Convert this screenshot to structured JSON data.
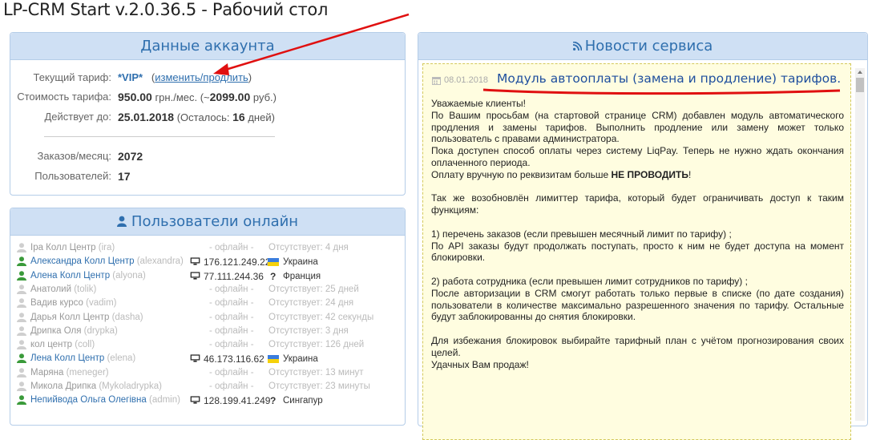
{
  "page_title": "LP-CRM Start v.2.0.36.5 - Рабочий стол",
  "account": {
    "title": "Данные аккаунта",
    "tariff_label": "Текущий тариф:",
    "tariff_value": "*VIP*",
    "change_link": "изменить/продлить",
    "cost_label": "Стоимость тарифа:",
    "cost_value": "950.00",
    "cost_suffix": " грн./мес. (~",
    "cost_alt": "2099.00",
    "cost_alt_suffix": " руб.)",
    "valid_label": "Действует до:",
    "valid_date": "25.01.2018",
    "remaining_prefix": " (Осталось: ",
    "remaining_days": "16",
    "remaining_suffix": " дней)",
    "orders_label": "Заказов/месяц:",
    "orders_value": "2072",
    "users_label": "Пользователей:",
    "users_value": "17"
  },
  "users_panel": {
    "title": "Пользователи онлайн",
    "rows": [
      {
        "name": "Ipa Колл Центр",
        "login": "(ira)",
        "online": false,
        "ip": "- офлайн -",
        "status": "Отсутствует: 4 дня"
      },
      {
        "name": "Александра Колл Центр",
        "login": "(alexandra)",
        "online": true,
        "ip": "176.121.249.229",
        "country": "Украина",
        "flag": "ua"
      },
      {
        "name": "Алена Колл Центр",
        "login": "(alyona)",
        "online": true,
        "ip": "77.111.244.36",
        "country": "Франция",
        "flag": "unknown"
      },
      {
        "name": "Анатолий",
        "login": "(tolik)",
        "online": false,
        "ip": "- офлайн -",
        "status": "Отсутствует: 25 дней"
      },
      {
        "name": "Вадив курсо",
        "login": "(vadim)",
        "online": false,
        "ip": "- офлайн -",
        "status": "Отсутствует: 24 дня"
      },
      {
        "name": "Дарья Колл Центр",
        "login": "(dasha)",
        "online": false,
        "ip": "- офлайн -",
        "status": "Отсутствует: 42 секунды"
      },
      {
        "name": "Дрипка Оля",
        "login": "(drypka)",
        "online": false,
        "ip": "- офлайн -",
        "status": "Отсутствует: 3 дня"
      },
      {
        "name": "кол центр",
        "login": "(coll)",
        "online": false,
        "ip": "- офлайн -",
        "status": "Отсутствует: 126 дней"
      },
      {
        "name": "Лена Колл Центр",
        "login": "(elena)",
        "online": true,
        "ip": "46.173.116.62",
        "country": "Украина",
        "flag": "ua"
      },
      {
        "name": "Маряна",
        "login": "(meneger)",
        "online": false,
        "ip": "- офлайн -",
        "status": "Отсутствует: 13 минут"
      },
      {
        "name": "Микола Дрипка",
        "login": "(Mykoladrypka)",
        "online": false,
        "ip": "- офлайн -",
        "status": "Отсутствует: 23 минуты"
      },
      {
        "name": "Непийвода Ольга Олегівна",
        "login": "(admin)",
        "online": true,
        "ip": "128.199.41.249",
        "country": "Сингапур",
        "flag": "unknown"
      }
    ]
  },
  "news": {
    "title": "Новости сервиса",
    "date": "08.01.2018",
    "headline": "Модуль автооплаты (замена и продление) тарифов.",
    "paragraphs": [
      "Уважаемые клиенты!",
      "По Вашим просьбам (на стартовой странице CRM) добавлен модуль автоматического продления и замены тарифов. Выполнить продление или замену может только пользователь с правами администратора.",
      "Пока доступен способ оплаты через систему LiqPay. Теперь не нужно ждать окончания оплаченного периода.",
      "",
      "",
      "Так же возобновлён лимиттер тарифа, который будет ограничивать доступ к таким функциям:",
      "",
      "1) перечень заказов (если превышен месячный лимит  по тарифу) ;",
      "По API заказы будут продолжать поступать, просто к ним не будет доступа на момент блокировки.",
      "",
      "2) работа сотрудника (если превышен лимит сотрудников  по тарифу) ;",
      "После авторизации в CRM смогут работать только первые в списке (по дате создания) пользователи  в количестве максимально разрешенного значения по тарифу. Остальные будут заблокированны до снятия блокировки.",
      "",
      "Для избежания блокировок выбирайте тарифный план с учётом прогнозирования своих целей.",
      "Удачных Вам продаж!"
    ],
    "manual_prefix": "Оплату вручную по реквизитам больше ",
    "manual_bold": "НЕ ПРОВОДИТЬ",
    "manual_suffix": "!"
  },
  "colors": {
    "panel_header_bg": "#cfe0f4",
    "accent_blue": "#2f6fae",
    "online_green": "#3a9a3a",
    "annotation_red": "#e01010",
    "news_bg": "#fffde0"
  }
}
